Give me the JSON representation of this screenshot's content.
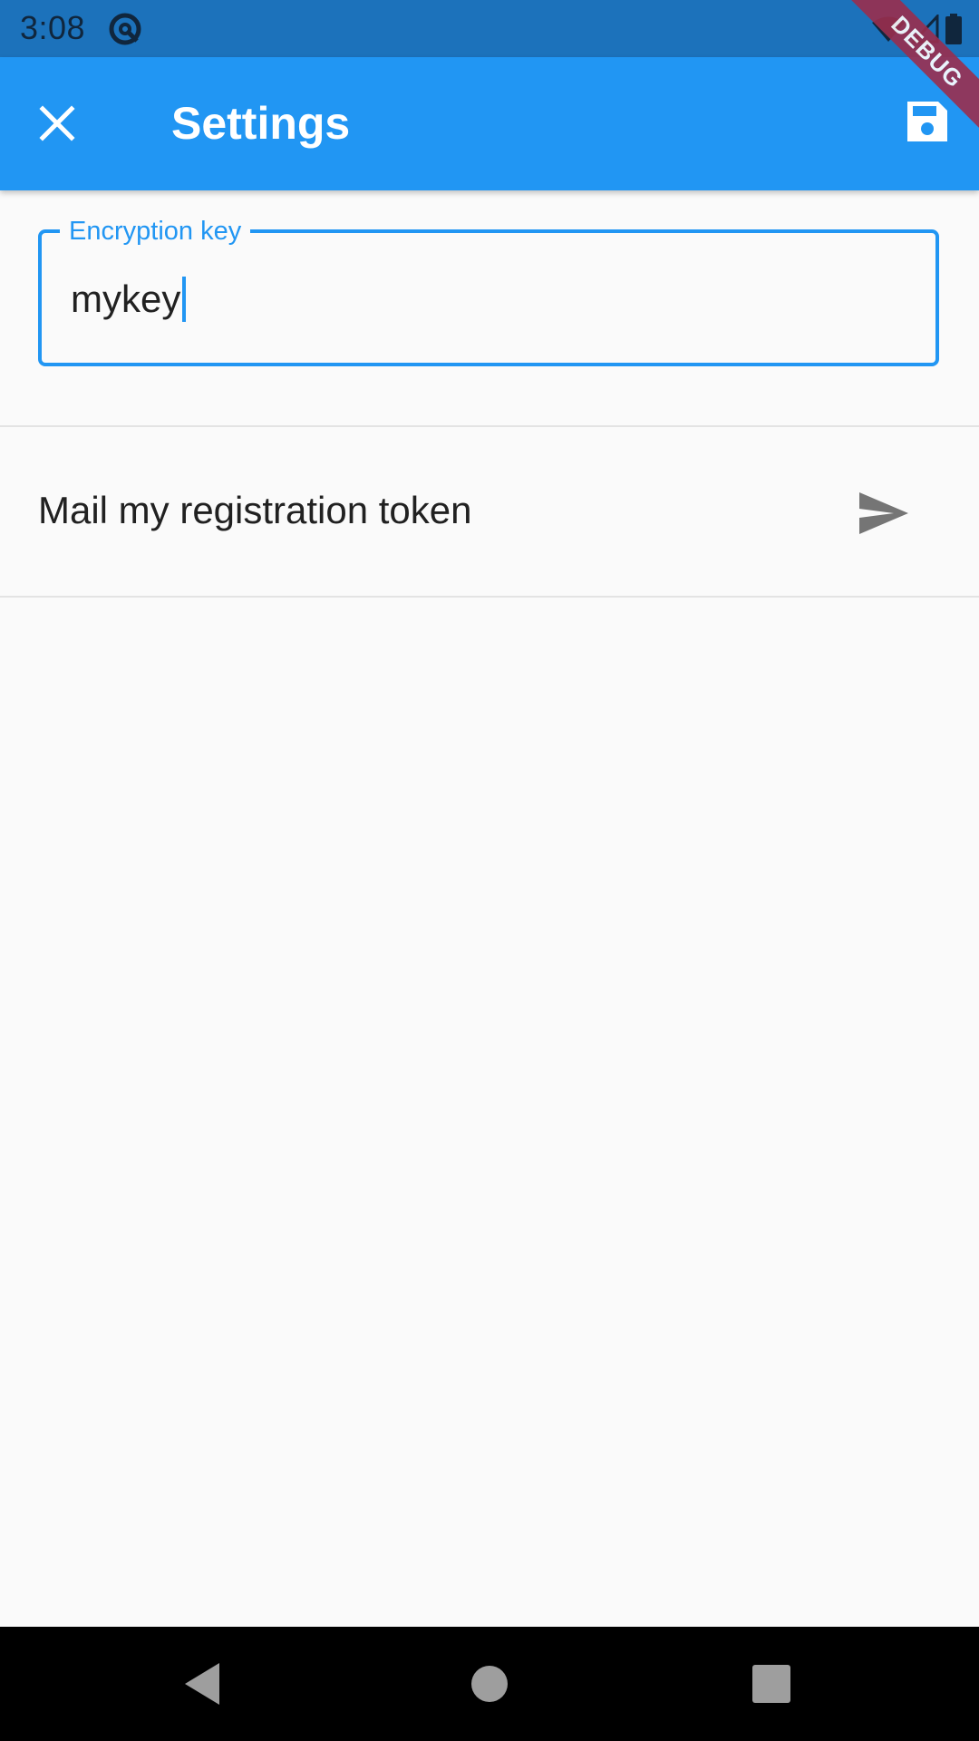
{
  "status_bar": {
    "time": "3:08",
    "icons": [
      "app-notification-icon",
      "wifi-icon",
      "cell-signal-icon",
      "battery-icon"
    ]
  },
  "debug_banner": {
    "label": "DEBUG"
  },
  "app_bar": {
    "title": "Settings",
    "leading_icon": "close-icon",
    "action_icon": "save-icon",
    "color": "#2196f3"
  },
  "form": {
    "encryption_key": {
      "label": "Encryption key",
      "value": "mykey"
    }
  },
  "list": {
    "items": [
      {
        "label": "Mail my registration token",
        "icon": "send-icon"
      }
    ]
  },
  "nav_bar": {
    "buttons": [
      "back-icon",
      "home-icon",
      "recents-icon"
    ]
  },
  "colors": {
    "primary": "#2196f3",
    "status_bar": "#1c72bb",
    "background": "#fafafa",
    "text": "#212121",
    "icon_grey": "#757575"
  }
}
